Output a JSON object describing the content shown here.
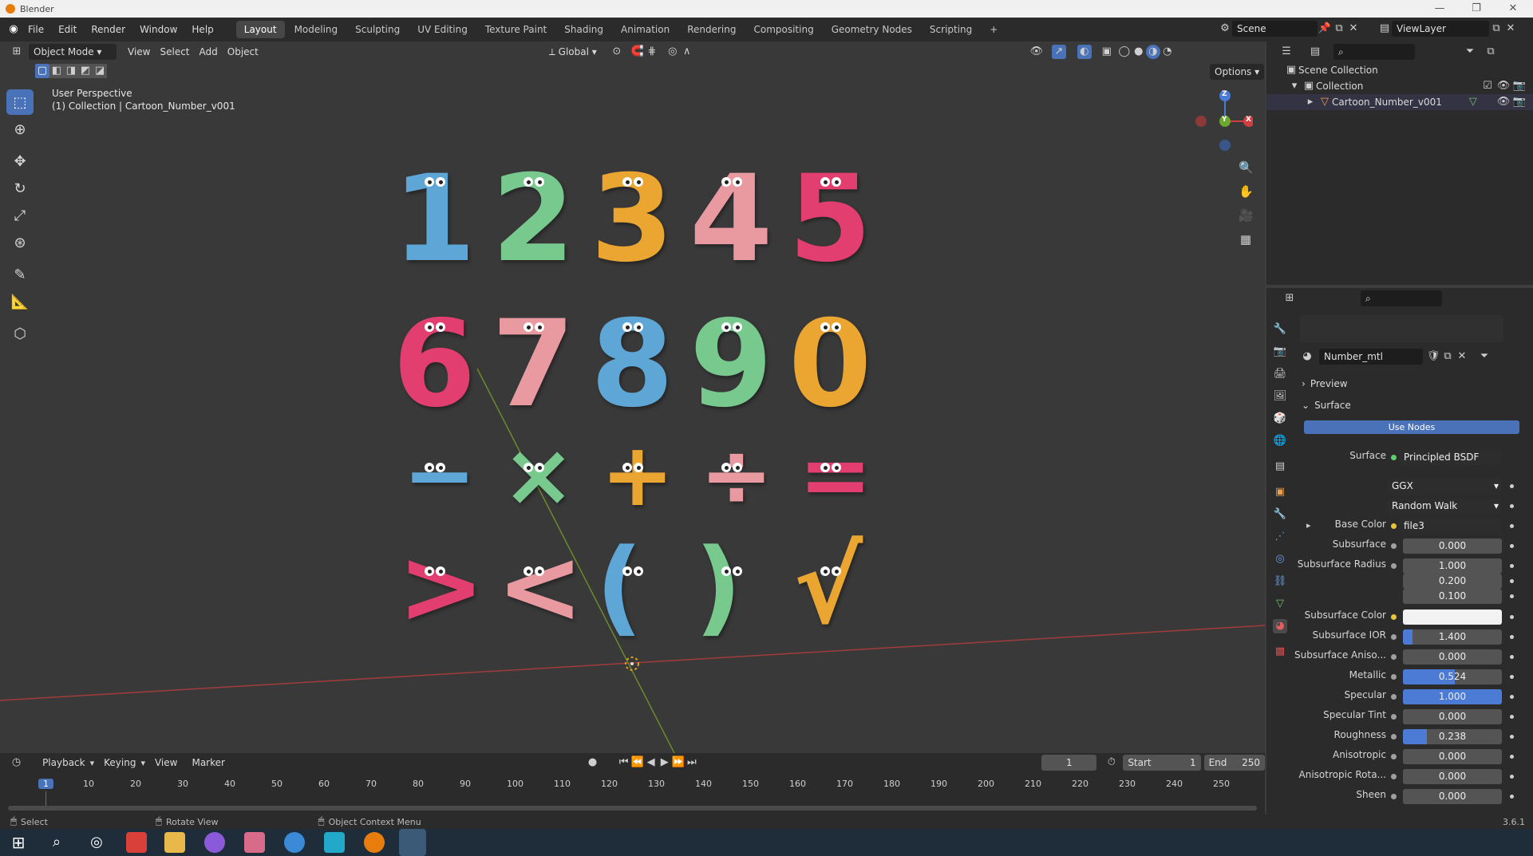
{
  "window": {
    "title": "Blender"
  },
  "menu": [
    "File",
    "Edit",
    "Render",
    "Window",
    "Help"
  ],
  "workspaces": [
    "Layout",
    "Modeling",
    "Sculpting",
    "UV Editing",
    "Texture Paint",
    "Shading",
    "Animation",
    "Rendering",
    "Compositing",
    "Geometry Nodes",
    "Scripting"
  ],
  "active_workspace": "Layout",
  "add_workspace": "+",
  "scene": "Scene",
  "view_layer": "ViewLayer",
  "viewport_header": {
    "mode": "Object Mode",
    "menus": [
      "View",
      "Select",
      "Add",
      "Object"
    ],
    "transform": "Global",
    "options": "Options"
  },
  "viewport_info": {
    "line1": "User Perspective",
    "line2": "(1) Collection | Cartoon_Number_v001"
  },
  "gizmo": {
    "z": "Z",
    "y": "Y",
    "x": "X"
  },
  "numbers": [
    {
      "char": "1",
      "color": "#5ea6d6"
    },
    {
      "char": "2",
      "color": "#78c98e"
    },
    {
      "char": "3",
      "color": "#eba632"
    },
    {
      "char": "4",
      "color": "#e89aa0"
    },
    {
      "char": "5",
      "color": "#e23e6f"
    },
    {
      "char": "6",
      "color": "#e23e6f"
    },
    {
      "char": "7",
      "color": "#e89aa0"
    },
    {
      "char": "8",
      "color": "#5ea6d6"
    },
    {
      "char": "9",
      "color": "#78c98e"
    },
    {
      "char": "0",
      "color": "#eba632"
    },
    {
      "char": "−",
      "color": "#5ea6d6"
    },
    {
      "char": "×",
      "color": "#78c98e"
    },
    {
      "char": "+",
      "color": "#eba632"
    },
    {
      "char": "÷",
      "color": "#e89aa0"
    },
    {
      "char": "=",
      "color": "#e23e6f"
    },
    {
      "char": ">",
      "color": "#e23e6f"
    },
    {
      "char": "<",
      "color": "#e89aa0"
    },
    {
      "char": "(",
      "color": "#5ea6d6"
    },
    {
      "char": ")",
      "color": "#78c98e"
    },
    {
      "char": "√",
      "color": "#eba632"
    }
  ],
  "outliner": {
    "root": "Scene Collection",
    "collection": "Collection",
    "object": "Cartoon_Number_v001"
  },
  "properties": {
    "material": "Number_mtl",
    "preview": "Preview",
    "surface_panel": "Surface",
    "use_nodes": "Use Nodes",
    "surface_label": "Surface",
    "surface_shader": "Principled BSDF",
    "distribution": "GGX",
    "subsurface_method": "Random Walk",
    "rows": [
      {
        "label": "Base Color",
        "value": "file3",
        "kind": "link"
      },
      {
        "label": "Subsurface",
        "value": "0.000",
        "fill": 0
      },
      {
        "label": "Subsurface Radius",
        "value": "1.000",
        "fill": 0
      },
      {
        "label": "",
        "value": "0.200",
        "fill": 0
      },
      {
        "label": "",
        "value": "0.100",
        "fill": 0
      },
      {
        "label": "Subsurface Color",
        "value": "",
        "kind": "color"
      },
      {
        "label": "Subsurface IOR",
        "value": "1.400",
        "fill": 0.1
      },
      {
        "label": "Subsurface Aniso...",
        "value": "0.000",
        "fill": 0
      },
      {
        "label": "Metallic",
        "value": "0.524",
        "fill": 0.524
      },
      {
        "label": "Specular",
        "value": "1.000",
        "fill": 1.0
      },
      {
        "label": "Specular Tint",
        "value": "0.000",
        "fill": 0
      },
      {
        "label": "Roughness",
        "value": "0.238",
        "fill": 0.238
      },
      {
        "label": "Anisotropic",
        "value": "0.000",
        "fill": 0
      },
      {
        "label": "Anisotropic Rota...",
        "value": "0.000",
        "fill": 0
      },
      {
        "label": "Sheen",
        "value": "0.000",
        "fill": 0
      }
    ]
  },
  "timeline": {
    "menus": [
      "Playback",
      "Keying",
      "View",
      "Marker"
    ],
    "current_frame": "1",
    "start_label": "Start",
    "start": "1",
    "end_label": "End",
    "end": "250",
    "ticks": [
      "1",
      "10",
      "20",
      "30",
      "40",
      "50",
      "60",
      "70",
      "80",
      "90",
      "100",
      "110",
      "120",
      "130",
      "140",
      "150",
      "160",
      "170",
      "180",
      "190",
      "200",
      "210",
      "220",
      "230",
      "240",
      "250"
    ]
  },
  "status": {
    "select": "Select",
    "rotate": "Rotate View",
    "context": "Object Context Menu",
    "version": "3.6.1"
  }
}
